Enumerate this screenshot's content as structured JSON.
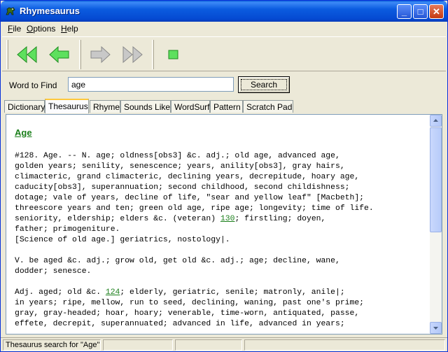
{
  "window": {
    "title": "Rhymesaurus",
    "controls": {
      "minimize": "_",
      "maximize": "□",
      "close": "✕"
    }
  },
  "menu": [
    {
      "label": "File",
      "key": "F",
      "rest": "ile"
    },
    {
      "label": "Options",
      "key": "O",
      "rest": "ptions"
    },
    {
      "label": "Help",
      "key": "H",
      "rest": "elp"
    }
  ],
  "toolbar": {
    "buttons": [
      {
        "name": "first",
        "icon": "double-left-arrow-icon",
        "color": "#33cc33"
      },
      {
        "name": "back",
        "icon": "left-arrow-icon",
        "color": "#33cc33"
      },
      {
        "name": "forward",
        "icon": "right-arrow-icon",
        "color": "#a0a0a0"
      },
      {
        "name": "last",
        "icon": "double-right-arrow-icon",
        "color": "#a0a0a0"
      },
      {
        "name": "stop",
        "icon": "stop-square-icon",
        "color": "#33cc33"
      }
    ]
  },
  "search": {
    "label": "Word to Find",
    "value": "age",
    "button_label": "Search"
  },
  "tabs": [
    {
      "label": "Dictionary",
      "active": false
    },
    {
      "label": "Thesaurus",
      "active": true
    },
    {
      "label": "Rhyme",
      "active": false
    },
    {
      "label": "Sounds Like",
      "active": false
    },
    {
      "label": "WordSurf",
      "active": false
    },
    {
      "label": "Pattern",
      "active": false
    },
    {
      "label": "Scratch Pad",
      "active": false
    }
  ],
  "content": {
    "heading": "Age",
    "lines": [
      "#128. Age. -- N. age; oldness[obs3] &c. adj.; old age, advanced age,",
      "golden years; senility, senescence; years, anility[obs3], gray hairs,",
      "climacteric, grand climacteric, declining years, decrepitude, hoary age,",
      "caducity[obs3], superannuation; second childhood, second childishness;",
      "dotage; vale of years, decline of life, \"sear and yellow leaf\" [Macbeth];",
      "threescore years and ten; green old age, ripe age; longevity; time of life.",
      "seniority, eldership; elders &c. (veteran) ",
      "; firstling; doyen,",
      "father; primogeniture.",
      "[Science of old age.] geriatrics, nostology|.",
      "",
      "V. be aged &c. adj.; grow old, get old &c. adj.; age; decline, wane,",
      "dodder; senesce.",
      "",
      "Adj. aged; old &c. ",
      "; elderly, geriatric, senile; matronly, anile|;",
      "in years; ripe, mellow, run to seed, declining, waning, past one's prime;",
      "gray, gray-headed; hoar, hoary; venerable, time-worn, antiquated, passe,",
      "effete, decrepit, superannuated; advanced in life, advanced in years;"
    ],
    "link1": "130",
    "link2": "124"
  },
  "status": {
    "message": "Thesaurus search for \"Age\""
  }
}
